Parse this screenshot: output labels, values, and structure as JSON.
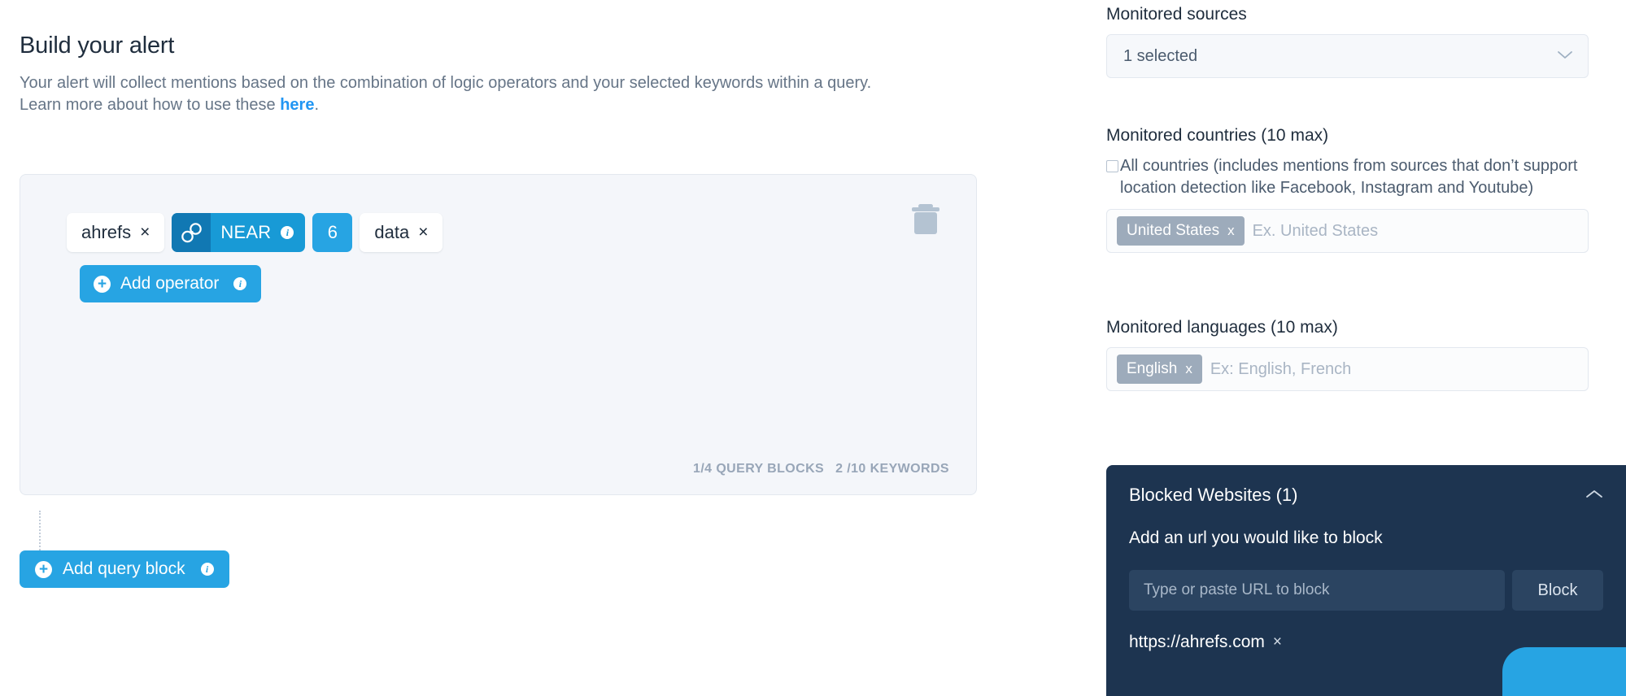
{
  "left": {
    "title": "Build your alert",
    "description_line1": "Your alert will collect mentions based on the combination of logic operators and your selected keywords within a query.",
    "description_line2_pre": "Learn more about how to use these ",
    "description_link": "here",
    "description_line2_post": ".",
    "query_block": {
      "delete_icon": "trash-icon",
      "chips": [
        {
          "type": "keyword",
          "label": "ahrefs",
          "remove": "×"
        },
        {
          "type": "operator",
          "label": "NEAR",
          "icon": "near-operator-icon",
          "info": "i"
        },
        {
          "type": "number",
          "label": "6"
        },
        {
          "type": "keyword",
          "label": "data",
          "remove": "×"
        }
      ],
      "add_operator_label": "Add operator",
      "add_operator_plus": "+",
      "add_operator_info": "i",
      "counter_blocks": "1/4 QUERY BLOCKS",
      "counter_keywords": "2 /10 KEYWORDS"
    },
    "add_query_block_label": "Add query block",
    "add_query_block_plus": "+",
    "add_query_block_info": "i"
  },
  "right": {
    "sources": {
      "label": "Monitored sources",
      "selected_text": "1 selected",
      "chevron": "⌄"
    },
    "countries": {
      "label": "Monitored countries (10 max)",
      "all_countries_text": "All countries (includes mentions from sources that don’t support location detection like Facebook, Instagram and Youtube)",
      "all_countries_checked": false,
      "tags": [
        {
          "label": "United States",
          "remove": "x"
        }
      ],
      "placeholder": "Ex. United States"
    },
    "languages": {
      "label": "Monitored languages (10 max)",
      "tags": [
        {
          "label": "English",
          "remove": "x"
        }
      ],
      "placeholder": "Ex: English, French"
    },
    "blocked_websites": {
      "title": "Blocked Websites (1)",
      "chevron": "⌃",
      "subtitle": "Add an url you would like to block",
      "input_placeholder": "Type or paste URL to block",
      "input_value": "",
      "block_button": "Block",
      "blocked_urls": [
        {
          "url": "https://ahrefs.com",
          "remove": "×"
        }
      ]
    }
  },
  "colors": {
    "accent": "#27a4e3",
    "operator_dark": "#1178b3",
    "operator": "#189ad6",
    "panel_dark": "#1d3450",
    "text_dark": "#1f2d3d",
    "text_muted": "#667587",
    "tag_grey": "#9dabbb"
  }
}
